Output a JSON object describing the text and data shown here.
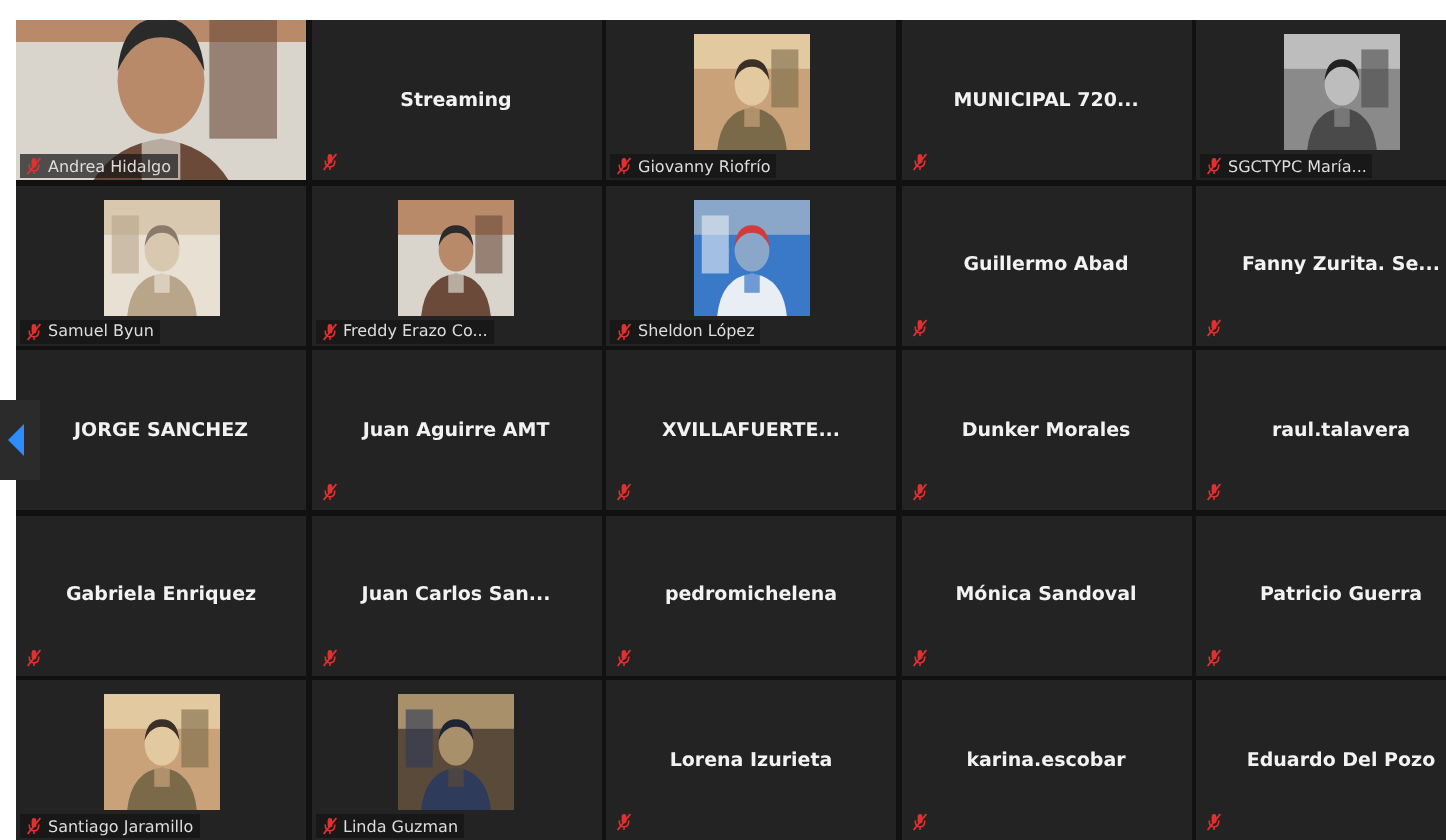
{
  "tiles": [
    {
      "kind": "video",
      "name": "Andrea Hidalgo",
      "muted": true
    },
    {
      "kind": "name",
      "name": "Streaming",
      "muted": true
    },
    {
      "kind": "avatar",
      "name": "Giovanny Riofrío",
      "muted": true
    },
    {
      "kind": "name",
      "name": "MUNICIPAL 720...",
      "muted": true
    },
    {
      "kind": "avatar",
      "name": "SGCTYPC  María...",
      "muted": true
    },
    {
      "kind": "avatar",
      "name": "Samuel Byun",
      "muted": true
    },
    {
      "kind": "avatar",
      "name": "Freddy Erazo Co...",
      "muted": true
    },
    {
      "kind": "avatar",
      "name": "Sheldon López",
      "muted": true
    },
    {
      "kind": "name",
      "name": "Guillermo Abad",
      "muted": true
    },
    {
      "kind": "name",
      "name": "Fanny  Zurita.  Se...",
      "muted": true
    },
    {
      "kind": "name",
      "name": "JORGE SANCHEZ",
      "muted": false
    },
    {
      "kind": "name",
      "name": "Juan Aguirre AMT",
      "muted": true
    },
    {
      "kind": "name",
      "name": "XVILLAFUERTE...",
      "muted": true
    },
    {
      "kind": "name",
      "name": "Dunker Morales",
      "muted": true
    },
    {
      "kind": "name",
      "name": "raul.talavera",
      "muted": true
    },
    {
      "kind": "name",
      "name": "Gabriela Enriquez",
      "muted": true
    },
    {
      "kind": "name",
      "name": "Juan  Carlos  San...",
      "muted": true
    },
    {
      "kind": "name",
      "name": "pedromichelena",
      "muted": true
    },
    {
      "kind": "name",
      "name": "Mónica Sandoval",
      "muted": true
    },
    {
      "kind": "name",
      "name": "Patricio Guerra",
      "muted": true
    },
    {
      "kind": "avatar",
      "name": "Santiago Jaramillo",
      "muted": true
    },
    {
      "kind": "avatar",
      "name": "Linda Guzman",
      "muted": true
    },
    {
      "kind": "name",
      "name": "Lorena Izurieta",
      "muted": true
    },
    {
      "kind": "name",
      "name": "karina.escobar",
      "muted": true
    },
    {
      "kind": "name",
      "name": "Eduardo Del Pozo",
      "muted": true
    }
  ]
}
